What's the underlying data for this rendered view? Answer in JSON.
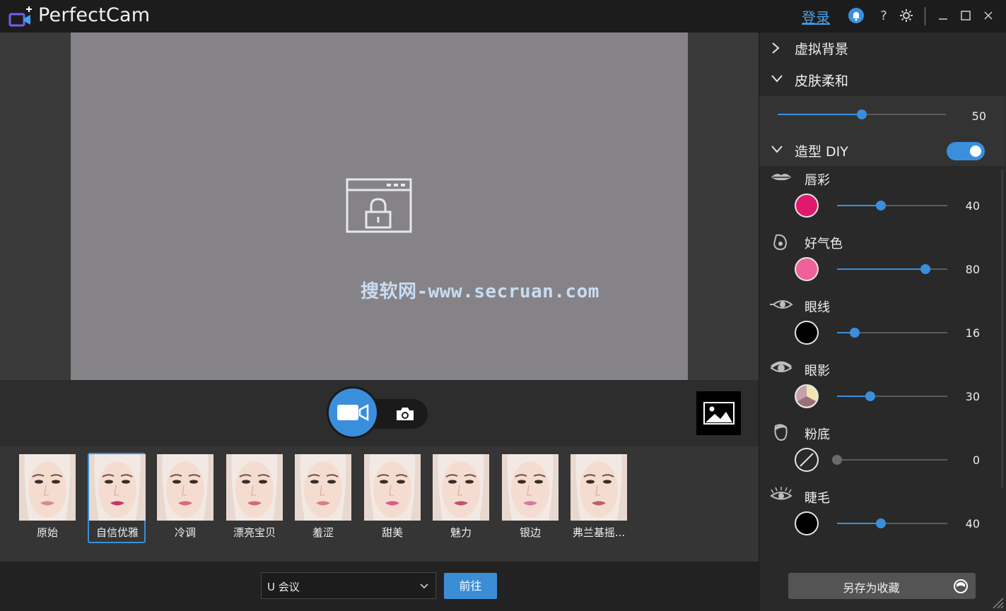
{
  "app": {
    "title": "PerfectCam",
    "login": "登录"
  },
  "titlebar": {
    "help": "?"
  },
  "watermark": "搜软网-www.secruan.com",
  "styles": [
    {
      "label": "原始"
    },
    {
      "label": "自信优雅"
    },
    {
      "label": "冷调"
    },
    {
      "label": "漂亮宝贝"
    },
    {
      "label": "羞涩"
    },
    {
      "label": "甜美"
    },
    {
      "label": "魅力"
    },
    {
      "label": "银边"
    },
    {
      "label": "弗兰基摇..."
    }
  ],
  "selected_style": "自信优雅",
  "meeting": {
    "value": "U 会议",
    "go_label": "前往"
  },
  "panel": {
    "virtual_background": "虚拟背景",
    "skin_smoothing": {
      "title": "皮肤柔和",
      "value": "50",
      "level": 0.5
    },
    "makeup_diy": {
      "title": "造型 DIY",
      "enabled": true
    },
    "makeup": [
      {
        "label": "唇彩",
        "value": "40",
        "level": 0.4,
        "color": "#e0196f",
        "icon": "lips-icon"
      },
      {
        "label": "好气色",
        "value": "80",
        "level": 0.8,
        "color": "#f0609a",
        "icon": "blush-face-icon"
      },
      {
        "label": "眼线",
        "value": "16",
        "level": 0.16,
        "color": "#000000",
        "icon": "eyeliner-icon"
      },
      {
        "label": "眼影",
        "value": "30",
        "level": 0.3,
        "color": "palette",
        "icon": "eyeshadow-icon"
      },
      {
        "label": "粉底",
        "value": "0",
        "level": 0.0,
        "color": "none",
        "icon": "foundation-face-icon"
      },
      {
        "label": "睫毛",
        "value": "40",
        "level": 0.4,
        "color": "#000000",
        "icon": "eyelash-icon"
      }
    ],
    "save_favorite": "另存为收藏"
  },
  "colors": {
    "accent": "#3a8fdd",
    "preview": "#858387"
  }
}
